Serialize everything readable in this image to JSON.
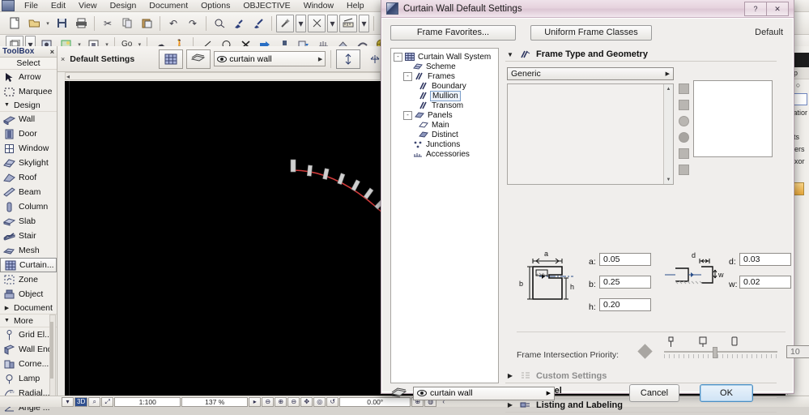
{
  "app": {
    "menu": [
      "File",
      "Edit",
      "View",
      "Design",
      "Document",
      "Options",
      "OBJECTIVE",
      "Window",
      "Help"
    ],
    "infobox": {
      "label": "Default Settings",
      "combo_value": "curtain wall"
    },
    "toolbar2_go": "Go"
  },
  "toolbox": {
    "title": "ToolBox",
    "close": "×",
    "select_header": "Select",
    "select_items": [
      {
        "label": "Arrow",
        "icon": "arrow-cursor-icon"
      },
      {
        "label": "Marquee",
        "icon": "marquee-icon"
      }
    ],
    "design_group": "Design",
    "design_items": [
      {
        "label": "Wall",
        "icon": "wall-icon"
      },
      {
        "label": "Door",
        "icon": "door-icon"
      },
      {
        "label": "Window",
        "icon": "window-icon"
      },
      {
        "label": "Skylight",
        "icon": "skylight-icon"
      },
      {
        "label": "Roof",
        "icon": "roof-icon"
      },
      {
        "label": "Beam",
        "icon": "beam-icon"
      },
      {
        "label": "Column",
        "icon": "column-icon"
      },
      {
        "label": "Slab",
        "icon": "slab-icon"
      },
      {
        "label": "Stair",
        "icon": "stair-icon"
      },
      {
        "label": "Mesh",
        "icon": "mesh-icon"
      },
      {
        "label": "Curtain...",
        "icon": "curtain-wall-icon",
        "selected": true
      },
      {
        "label": "Zone",
        "icon": "zone-icon"
      },
      {
        "label": "Object",
        "icon": "object-icon"
      }
    ],
    "document_group": "Document",
    "more_group": "More",
    "more_items": [
      {
        "label": "Grid El...",
        "icon": "grid-element-icon"
      },
      {
        "label": "Wall End",
        "icon": "wall-end-icon"
      },
      {
        "label": "Corne...",
        "icon": "corner-window-icon"
      },
      {
        "label": "Lamp",
        "icon": "lamp-icon"
      },
      {
        "label": "Radial...",
        "icon": "radial-dimension-icon"
      },
      {
        "label": "Angle ...",
        "icon": "angle-dimension-icon"
      }
    ]
  },
  "statusbar": {
    "scale": "1:100",
    "zoom": "137 %",
    "angle": "0.00°",
    "buttons": [
      "3d-icon",
      "zoom-window-icon",
      "fit-window-icon"
    ],
    "zoom_buttons": [
      "zoom-pct-icon",
      "zoom-in-icon",
      "zoom-out-icon",
      "pan-icon",
      "orbit-icon",
      "prev-zoom-icon"
    ],
    "right_buttons": [
      "zoom-marker-icon",
      "globe-icon"
    ],
    "overflow": "‹"
  },
  "navigator": {
    "tab_label": "ap",
    "rows": [
      "vatior",
      "s",
      "nts",
      "Pers",
      "Axor"
    ],
    "highlight": "y"
  },
  "dialog": {
    "title": "Curtain Wall Default Settings",
    "window_buttons": [
      {
        "name": "help-button",
        "glyph": "?"
      },
      {
        "name": "close-button",
        "glyph": "✕"
      }
    ],
    "favorites_button": "Frame Favorites...",
    "uniform_button": "Uniform Frame Classes",
    "default_label": "Default",
    "tree": [
      {
        "label": "Curtain Wall System",
        "depth": 0,
        "toggle": "-",
        "icon": "curtain-wall-system-icon"
      },
      {
        "label": "Scheme",
        "depth": 1,
        "toggle": "",
        "icon": "scheme-icon"
      },
      {
        "label": "Frames",
        "depth": 1,
        "toggle": "-",
        "icon": "frames-icon"
      },
      {
        "label": "Boundary",
        "depth": 2,
        "toggle": "",
        "icon": "boundary-icon"
      },
      {
        "label": "Mullion",
        "depth": 2,
        "toggle": "",
        "icon": "mullion-icon",
        "selected": true
      },
      {
        "label": "Transom",
        "depth": 2,
        "toggle": "",
        "icon": "transom-icon"
      },
      {
        "label": "Panels",
        "depth": 1,
        "toggle": "-",
        "icon": "panels-icon"
      },
      {
        "label": "Main",
        "depth": 2,
        "toggle": "",
        "icon": "main-panel-icon"
      },
      {
        "label": "Distinct",
        "depth": 2,
        "toggle": "",
        "icon": "distinct-panel-icon"
      },
      {
        "label": "Junctions",
        "depth": 1,
        "toggle": "",
        "icon": "junctions-icon"
      },
      {
        "label": "Accessories",
        "depth": 1,
        "toggle": "",
        "icon": "accessories-icon"
      }
    ],
    "section_frame": "Frame Type and Geometry",
    "type_combo": "Generic",
    "view_strip": [
      "2d-view-icon",
      "elevation-view-icon",
      "3d-wire-icon",
      "3d-solid-icon",
      "plan-view-icon",
      "section-view-icon"
    ],
    "geometry": {
      "a_label": "a:",
      "a_value": "0.05",
      "b_label": "b:",
      "b_value": "0.25",
      "h_label": "h:",
      "h_value": "0.20",
      "d_label": "d:",
      "d_value": "0.03",
      "w_label": "w:",
      "w_value": "0.02",
      "diagram_letters": {
        "a": "a",
        "b": "b",
        "h": "h",
        "d": "d",
        "w": "w"
      }
    },
    "fip_label": "Frame Intersection Priority:",
    "fip_value": "10",
    "sections": [
      {
        "label": "Custom Settings",
        "icon": "custom-settings-icon",
        "muted": true
      },
      {
        "label": "Model",
        "icon": "model-icon",
        "muted": false
      },
      {
        "label": "Listing and Labeling",
        "icon": "listing-labeling-icon",
        "muted": false
      }
    ],
    "layer_combo": "curtain wall",
    "cancel": "Cancel",
    "ok": "OK"
  }
}
